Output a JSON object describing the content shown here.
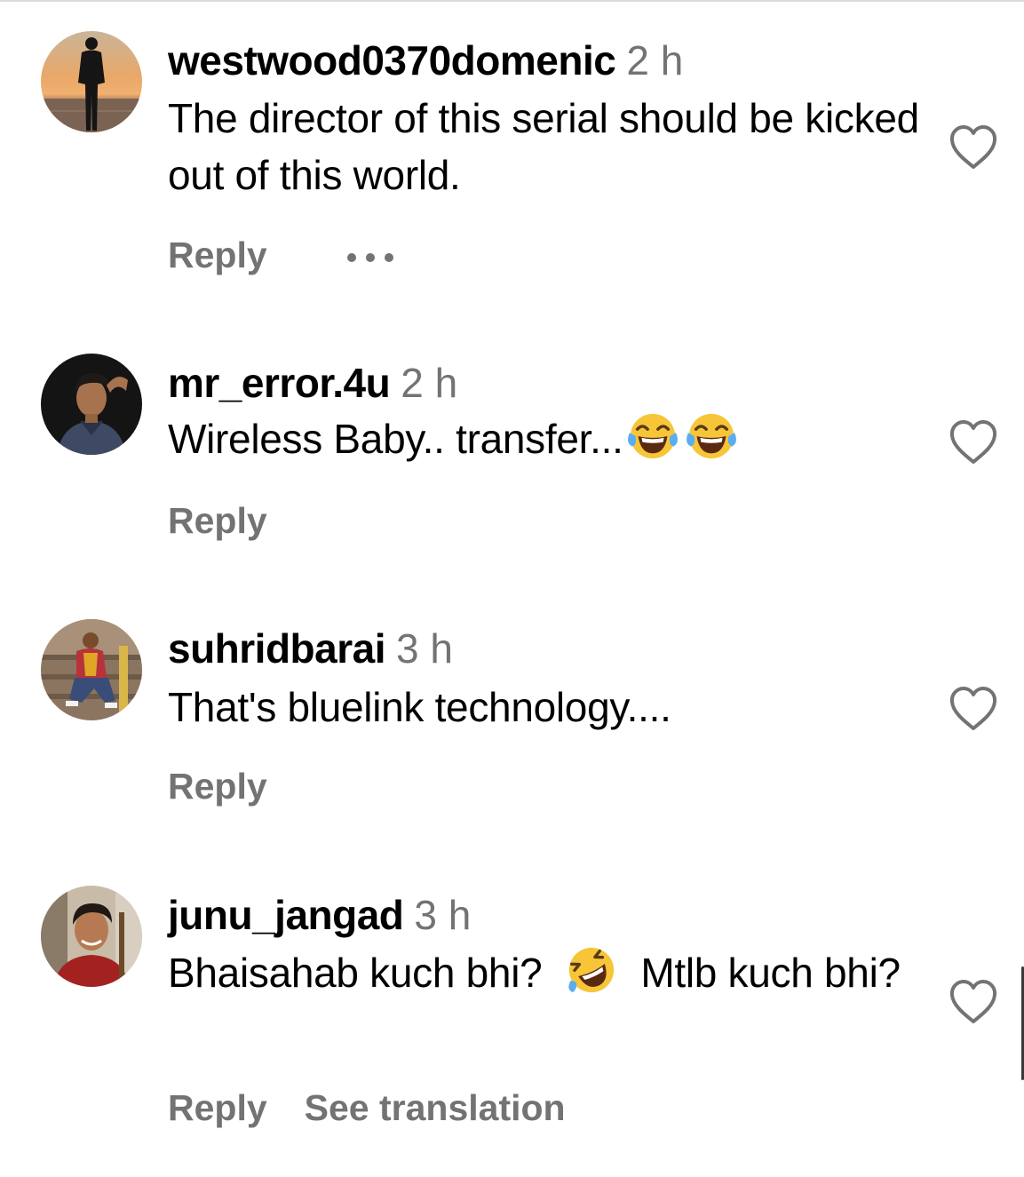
{
  "comments": [
    {
      "username": "westwood0370domenic",
      "time": "2 h",
      "text": "The director of this serial should be kicked out of this world.",
      "reply_label": "Reply",
      "avatar": "silhouette-sunset-avatar"
    },
    {
      "username": "mr_error.4u",
      "time": "2 h",
      "text": "Wireless Baby.. transfer...",
      "emojis": [
        "face-with-tears-of-joy",
        "face-with-tears-of-joy"
      ],
      "reply_label": "Reply",
      "avatar": "man-portrait-dark-avatar"
    },
    {
      "username": "suhridbarai",
      "time": "3 h",
      "text": "That's bluelink technology....",
      "reply_label": "Reply",
      "avatar": "man-crouching-avatar"
    },
    {
      "username": "junu_jangad",
      "time": "3 h",
      "text_before": "Bhaisahab kuch bhi?",
      "emoji": "rolling-on-floor-laughing",
      "text_after": "Mtlb kuch bhi?",
      "reply_label": "Reply",
      "translate_label": "See translation",
      "avatar": "man-smiling-avatar"
    }
  ],
  "colors": {
    "text": "#000000",
    "muted": "#737373",
    "heart_stroke": "#737373"
  },
  "icons": {
    "like": "heart-outline-icon",
    "more": "more-options-icon"
  }
}
